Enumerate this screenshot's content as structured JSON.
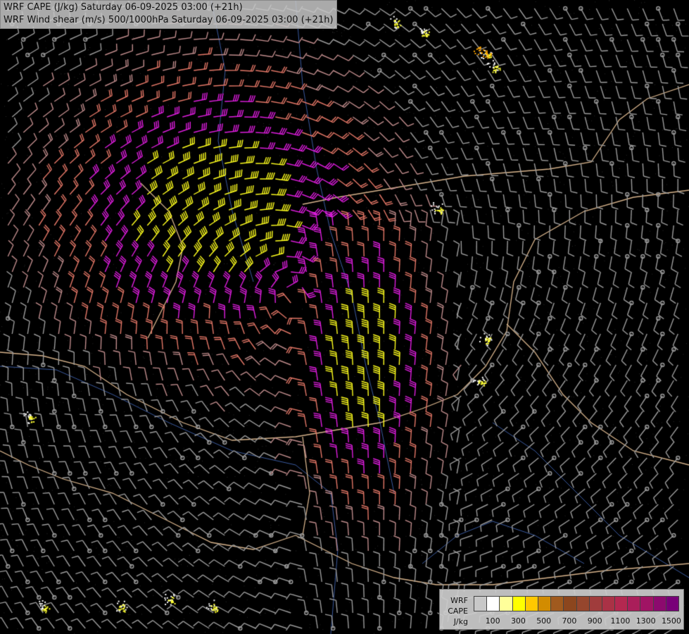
{
  "header": {
    "line1": "WRF CAPE (J/kg) Saturday 06-09-2025 03:00 (+21h)",
    "line2": "WRF Wind shear (m/s) 500/1000hPa Saturday 06-09-2025 03:00 (+21h)"
  },
  "legend": {
    "line1": "WRF",
    "line2": "CAPE",
    "line3": "J/kg",
    "swatches": [
      "#c8c8c8",
      "#ffffff",
      "#ffff9a",
      "#ffff00",
      "#ffc800",
      "#d28c00",
      "#a05a1e",
      "#8c461e",
      "#96462d",
      "#a03c3c",
      "#aa3246",
      "#b42850",
      "#aa1e5a",
      "#a01464",
      "#8c0a6e",
      "#780078"
    ],
    "ticks": [
      "100",
      "300",
      "500",
      "700",
      "900",
      "1100",
      "1300",
      "1500"
    ]
  },
  "shear_colors": {
    "weak": "#9c9c9c",
    "weak_mid": "#c08c8c",
    "moderate": "#e67868",
    "strong": "#e01ee0",
    "very_strong": "#ffff1e"
  }
}
